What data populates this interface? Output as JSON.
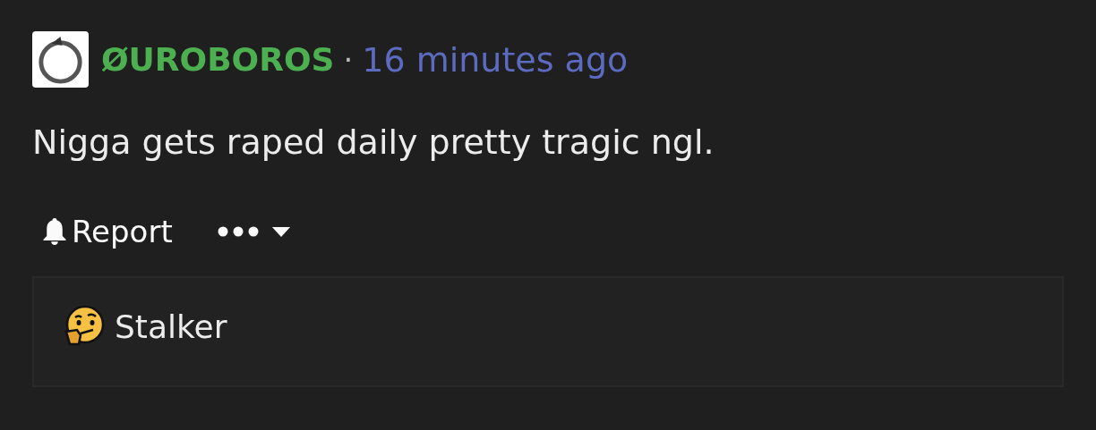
{
  "comment": {
    "author": "ØUROBOROS",
    "separator": "·",
    "time": "16 minutes ago",
    "body": "Nigga gets raped daily pretty tragic ngl.",
    "actions": [
      {
        "kind": "report",
        "label": "Report"
      },
      {
        "kind": "more"
      }
    ]
  },
  "flair": {
    "label": "Stalker"
  }
}
